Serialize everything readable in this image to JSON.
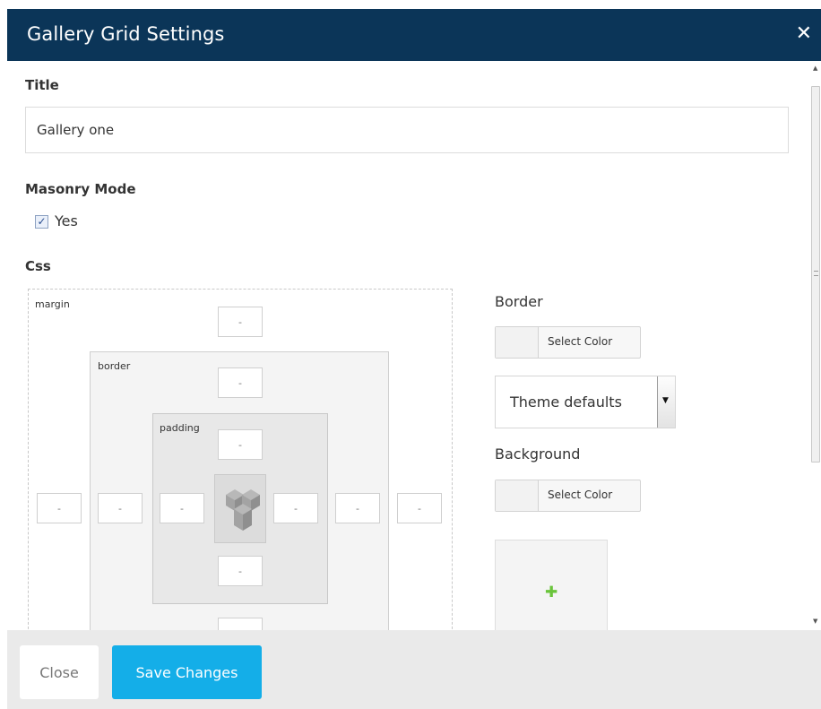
{
  "dialog": {
    "title": "Gallery Grid Settings",
    "close_icon": "close-icon"
  },
  "form": {
    "title_label": "Title",
    "title_value": "Gallery one",
    "masonry_label": "Masonry Mode",
    "masonry_checked": true,
    "masonry_option": "Yes",
    "css_label": "Css"
  },
  "css_box": {
    "margin_label": "margin",
    "border_label": "border",
    "padding_label": "padding",
    "placeholder": "-",
    "margin": {
      "top": "",
      "bottom": "",
      "left": "",
      "right": ""
    },
    "border": {
      "top": "",
      "bottom": "",
      "left": "",
      "right": ""
    },
    "padding": {
      "top": "",
      "bottom": "",
      "left": "",
      "right": ""
    },
    "logo_icon": "vc-logo-icon"
  },
  "style": {
    "border_label": "Border",
    "border_color_button": "Select Color",
    "border_style_selected": "Theme defaults",
    "background_label": "Background",
    "background_color_button": "Select Color",
    "add_image_icon": "plus-icon"
  },
  "footer": {
    "close_label": "Close",
    "save_label": "Save Changes"
  },
  "colors": {
    "header_bg": "#0b3558",
    "primary_button": "#14aee8",
    "plus_icon": "#6ac43b"
  }
}
